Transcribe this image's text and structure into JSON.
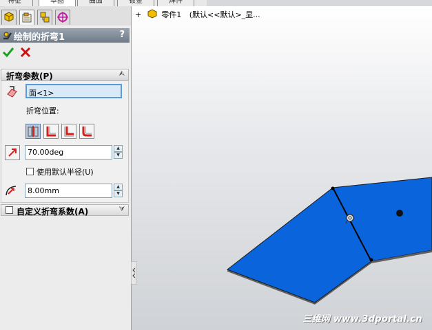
{
  "top_tabs": [
    "特征",
    "草图",
    "曲面",
    "钣金",
    "焊件"
  ],
  "panel": {
    "title": "绘制的折弯1",
    "help": "?",
    "bend_params": {
      "header": "折弯参数(P)",
      "face_value": "面<1>",
      "position_label": "折弯位置:",
      "angle_value": "70.00deg",
      "use_default_radius": "使用默认半径(U)",
      "radius_value": "8.00mm"
    },
    "custom_factor": {
      "header": "自定义折弯系数(A)"
    }
  },
  "feature_tree": {
    "expand": "+",
    "part_name": "零件1",
    "config": "(默认<<默认>_显..."
  },
  "watermark": "三维网 www.3dportal.cn",
  "colors": {
    "sheet": "#0a64dc",
    "title_bar": "#7f8a98"
  }
}
